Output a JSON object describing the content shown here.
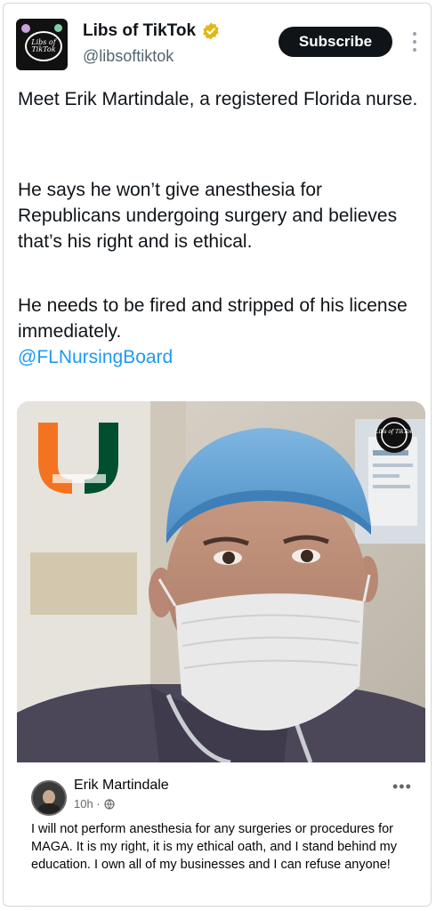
{
  "account": {
    "display_name": "Libs of TikTok",
    "handle": "@libsoftiktok",
    "avatar_text": "Libs of TikTok"
  },
  "actions": {
    "subscribe_label": "Subscribe"
  },
  "tweet": {
    "paragraph_1": "Meet Erik Martindale, a registered Florida nurse.",
    "paragraph_2": "He says he won’t give anesthesia for Republicans undergoing surgery and believes that’s his right and is ethical.",
    "paragraph_3": "He needs to be fired and stripped of his license immediately.",
    "mention": "@FLNursingBoard"
  },
  "media": {
    "watermark_text": "Libs of TikTok",
    "facebook_post": {
      "author": "Erik Martindale",
      "time": "10h ·",
      "text": "I will not perform anesthesia for any surgeries or procedures for MAGA. It is my right, it is my ethical oath, and I stand behind my education. I own all of my businesses and I can refuse anyone!"
    }
  },
  "colors": {
    "mention": "#1d9bf0",
    "verified_badge": "#e2b719",
    "subscribe_bg": "#0f1419",
    "scrubs_cap": "#5b9fd4",
    "um_orange": "#f47321",
    "um_green": "#005030"
  },
  "icons": [
    "verified-badge-icon",
    "more-options-icon",
    "globe-icon",
    "post-options-icon"
  ]
}
